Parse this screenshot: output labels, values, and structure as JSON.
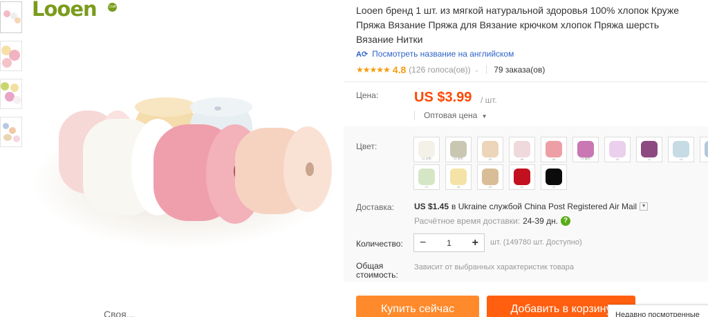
{
  "brand": {
    "logo_text": "Looen",
    "logo_sub": "Craft"
  },
  "product": {
    "title_line1": "Looen бренд 1 шт. из мягкой натуральной здоровья 100% хлопок Круже",
    "title_line2": "Пряжа Вязание Пряжа для Вязание крючком хлопок Пряжа шерсть",
    "title_line3": "Вязание Нитки",
    "translate_link": "Посмотреть название на английском",
    "rating": "4.8",
    "votes": "(126 голоса(ов))",
    "orders": "79 заказа(ов)"
  },
  "price": {
    "label": "Цена:",
    "value": "US $3.99",
    "unit": "/ шт.",
    "wholesale": "Оптовая цена"
  },
  "color": {
    "label": "Цвет:",
    "swatches": [
      {
        "color": "#f4f1e8",
        "caption": "01 白色"
      },
      {
        "color": "#c9c6b2",
        "caption": "02 米色"
      },
      {
        "color": "#ecd5b8",
        "caption": "03"
      },
      {
        "color": "#f0d9dc",
        "caption": "05"
      },
      {
        "color": "#ee9fa6",
        "caption": "06"
      },
      {
        "color": "#c978b3",
        "caption": "09 紫色"
      },
      {
        "color": "#ead0ec",
        "caption": "10"
      },
      {
        "color": "#8c4a80",
        "caption": "12"
      },
      {
        "color": "#c6dbe4",
        "caption": "14"
      },
      {
        "color": "#b3c8dc",
        "caption": "15"
      },
      {
        "color": "#d5e6c5",
        "caption": "17"
      },
      {
        "color": "#f3e3a6",
        "caption": "18"
      },
      {
        "color": "#d8bd96",
        "caption": "19"
      },
      {
        "color": "#c2101f",
        "caption": "21"
      },
      {
        "color": "#0b0b0b",
        "caption": "22"
      }
    ]
  },
  "shipping": {
    "label": "Доставка:",
    "price": "US $1.45",
    "text": "в Ukraine службой China Post Registered Air Mail",
    "eta_label": "Расчётное время доставки:",
    "eta_days": "24-39 дн."
  },
  "quantity": {
    "label": "Количество:",
    "minus": "−",
    "value": "1",
    "plus": "+",
    "available": "шт. (149780 шт. Доступно)"
  },
  "total": {
    "label": "Общая стоимость:",
    "text": "Зависит от выбранных характеристик товара"
  },
  "buttons": {
    "buy_now": "Купить сейчас",
    "add_to_cart": "Добавить в корзину"
  },
  "recently_viewed": "Недавно посмотренные",
  "image_caption": "Своя...",
  "colors": {
    "accent": "#ff4700",
    "buy": "#ff8a2b",
    "cart": "#ff5f0f",
    "link": "#2d63c9",
    "brand": "#7a9c1c"
  }
}
